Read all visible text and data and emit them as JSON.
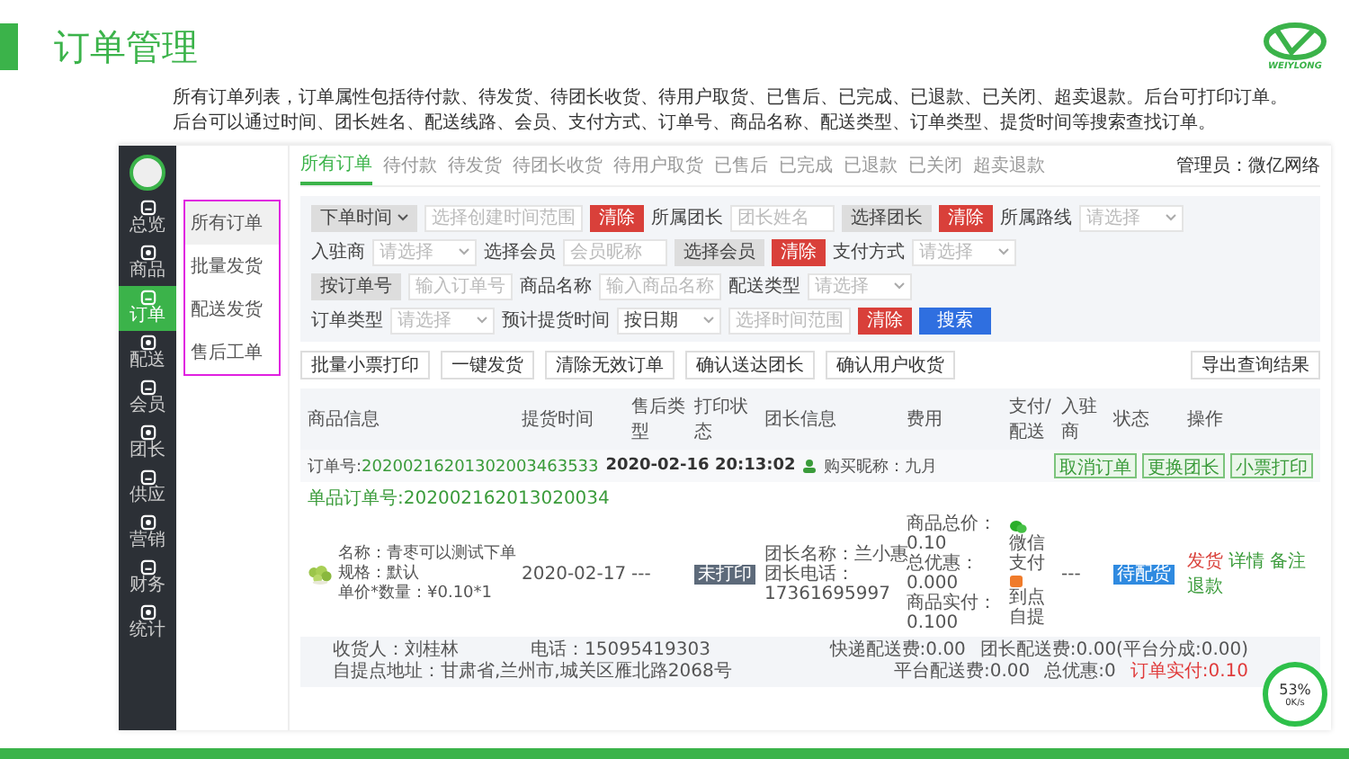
{
  "slide": {
    "title": "订单管理",
    "logo_text": "WEIYLONG",
    "description": [
      "所有订单列表，订单属性包括待付款、待发货、待团长收货、待用户取货、已售后、已完成、已退款、已关闭、超卖退款。后台可打印订单。",
      "后台可以通过时间、团长姓名、配送线路、会员、支付方式、订单号、商品名称、配送类型、订单类型、提货时间等搜索查找订单。"
    ]
  },
  "sidebar": {
    "items": [
      {
        "label": "总览",
        "selected": false
      },
      {
        "label": "商品",
        "selected": false
      },
      {
        "label": "订单",
        "selected": true
      },
      {
        "label": "配送",
        "selected": false
      },
      {
        "label": "会员",
        "selected": false
      },
      {
        "label": "团长",
        "selected": false
      },
      {
        "label": "供应",
        "selected": false
      },
      {
        "label": "营销",
        "selected": false
      },
      {
        "label": "财务",
        "selected": false
      },
      {
        "label": "统计",
        "selected": false
      }
    ]
  },
  "submenu": [
    {
      "label": "所有订单",
      "selected": true
    },
    {
      "label": "批量发货",
      "selected": false
    },
    {
      "label": "配送发货",
      "selected": false
    },
    {
      "label": "售后工单",
      "selected": false
    }
  ],
  "tabs": [
    {
      "label": "所有订单",
      "selected": true
    },
    {
      "label": "待付款",
      "selected": false
    },
    {
      "label": "待发货",
      "selected": false
    },
    {
      "label": "待团长收货",
      "selected": false
    },
    {
      "label": "待用户取货",
      "selected": false
    },
    {
      "label": "已售后",
      "selected": false
    },
    {
      "label": "已完成",
      "selected": false
    },
    {
      "label": "已退款",
      "selected": false
    },
    {
      "label": "已关闭",
      "selected": false
    },
    {
      "label": "超卖退款",
      "selected": false
    }
  ],
  "admin": "管理员：微亿网络",
  "filters": [
    [
      {
        "kind": "dropdown",
        "text": "下单时间"
      },
      {
        "kind": "input",
        "placeholder": "选择创建时间范围"
      },
      {
        "kind": "danger",
        "text": "清除"
      },
      {
        "kind": "label",
        "text": "所属团长"
      },
      {
        "kind": "input",
        "placeholder": "团长姓名"
      },
      {
        "kind": "grey",
        "text": "选择团长"
      },
      {
        "kind": "danger",
        "text": "清除"
      },
      {
        "kind": "label",
        "text": "所属路线"
      },
      {
        "kind": "select",
        "placeholder": "请选择"
      }
    ],
    [
      {
        "kind": "label",
        "text": "入驻商"
      },
      {
        "kind": "select",
        "placeholder": "请选择"
      },
      {
        "kind": "label",
        "text": "选择会员"
      },
      {
        "kind": "input",
        "placeholder": "会员昵称"
      },
      {
        "kind": "grey",
        "text": "选择会员"
      },
      {
        "kind": "danger",
        "text": "清除"
      },
      {
        "kind": "label",
        "text": "支付方式"
      },
      {
        "kind": "select",
        "placeholder": "请选择"
      }
    ],
    [
      {
        "kind": "grey",
        "text": "按订单号"
      },
      {
        "kind": "input",
        "placeholder": "输入订单号"
      },
      {
        "kind": "label",
        "text": "商品名称"
      },
      {
        "kind": "input",
        "placeholder": "输入商品名称"
      },
      {
        "kind": "label",
        "text": "配送类型"
      },
      {
        "kind": "select",
        "placeholder": "请选择"
      }
    ],
    [
      {
        "kind": "label",
        "text": "订单类型"
      },
      {
        "kind": "select",
        "placeholder": "请选择"
      },
      {
        "kind": "label",
        "text": "预计提货时间"
      },
      {
        "kind": "select",
        "value": "按日期"
      },
      {
        "kind": "input",
        "placeholder": "选择时间范围"
      },
      {
        "kind": "danger",
        "text": "清除"
      },
      {
        "kind": "primary",
        "text": "搜索"
      }
    ]
  ],
  "actions": [
    "批量小票打印",
    "一键发货",
    "清除无效订单",
    "确认送达团长",
    "确认用户收货"
  ],
  "export_button": "导出查询结果",
  "table": {
    "columns": [
      "商品信息",
      "提货时间",
      "售后类型",
      "打印状态",
      "团长信息",
      "费用",
      "支付/配送",
      "入驻商",
      "状态",
      "操作"
    ],
    "order": {
      "number_label": "订单号:",
      "number": "20200216201302003463533",
      "time": "2020-02-16 20:13:02",
      "buyer": "购买昵称：九月",
      "buttons": [
        "取消订单",
        "更换团长",
        "小票打印"
      ],
      "sub_number": "单品订单号:202002162013020034",
      "item": {
        "kind": "picture",
        "name": "名称：青枣可以测试下单",
        "spec": "规格：默认",
        "price": "单价*数量：¥0.10*1",
        "pickup": "2020-02-17",
        "after_sale": "---",
        "print": "未打印",
        "leader": [
          "团长名称：兰小惠",
          "团长电话：",
          "17361695997"
        ],
        "fees": [
          "商品总价：",
          "0.10",
          "总优惠：",
          "0.000",
          "商品实付：",
          "0.100"
        ],
        "payment": "微信支付",
        "delivery": "到点自提",
        "merchant": "---",
        "status": "待配货",
        "ops": [
          {
            "text": "发货",
            "kind": "danger"
          },
          {
            "text": "详情",
            "kind": "link"
          },
          {
            "text": "备注",
            "kind": "link"
          },
          {
            "text": "退款",
            "kind": "link"
          }
        ]
      },
      "receiver": "收货人：刘桂林",
      "phone": "电话：15095419303",
      "address": "自提点地址：甘肃省,兰州市,城关区雁北路2068号",
      "fee_lines": [
        [
          "快递配送费:0.00",
          "团长配送费:0.00(平台分成:0.00)"
        ],
        [
          "平台配送费:0.00",
          "总优惠:0",
          "订单实付:0.10"
        ]
      ]
    }
  },
  "widget": {
    "percent": "53%",
    "speed": "0K/s"
  }
}
